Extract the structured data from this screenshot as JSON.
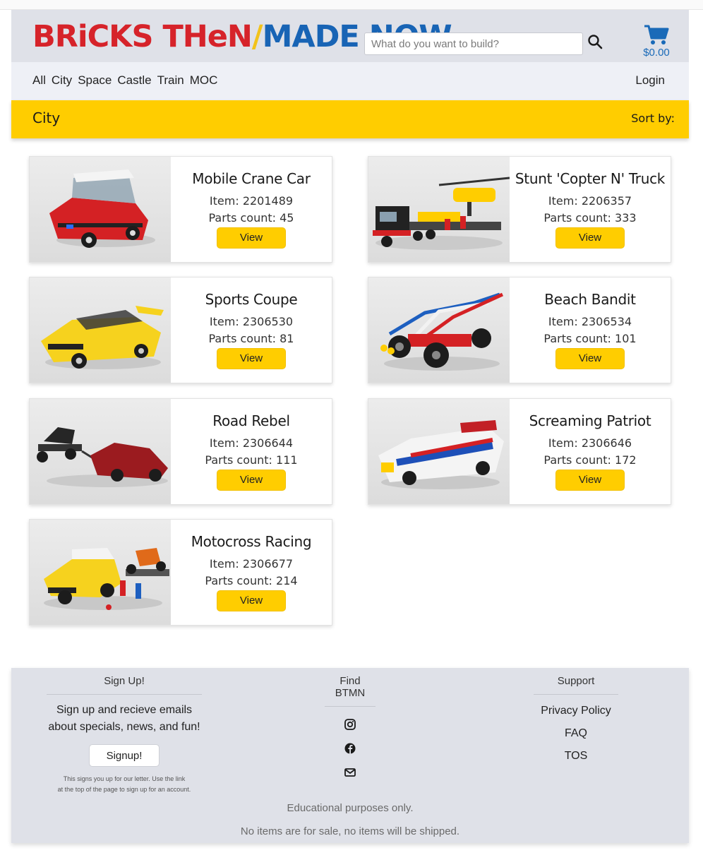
{
  "header": {
    "logo": {
      "part1": "BRiCKS THeN",
      "slash": "/",
      "part2": "MADE NOW"
    },
    "search": {
      "placeholder": "What do you want to build?"
    },
    "cart_total": "$0.00"
  },
  "nav": {
    "links": [
      "All",
      "City",
      "Space",
      "Castle",
      "Train",
      "MOC"
    ],
    "login": "Login"
  },
  "category": {
    "title": "City",
    "sort_label": "Sort by:"
  },
  "products": [
    {
      "name": "Mobile Crane Car",
      "item": "Item: 2201489",
      "parts": "Parts count: 45",
      "view": "View"
    },
    {
      "name": "Stunt 'Copter N' Truck",
      "item": "Item: 2206357",
      "parts": "Parts count: 333",
      "view": "View"
    },
    {
      "name": "Sports Coupe",
      "item": "Item: 2306530",
      "parts": "Parts count: 81",
      "view": "View"
    },
    {
      "name": "Beach Bandit",
      "item": "Item: 2306534",
      "parts": "Parts count: 101",
      "view": "View"
    },
    {
      "name": "Road Rebel",
      "item": "Item: 2306644",
      "parts": "Parts count: 111",
      "view": "View"
    },
    {
      "name": "Screaming Patriot",
      "item": "Item: 2306646",
      "parts": "Parts count: 172",
      "view": "View"
    },
    {
      "name": "Motocross Racing",
      "item": "Item: 2306677",
      "parts": "Parts count: 214",
      "view": "View"
    }
  ],
  "footer": {
    "signup": {
      "heading": "Sign Up!",
      "text_line1": "Sign up and recieve emails",
      "text_line2": "about specials, news, and fun!",
      "button": "Signup!",
      "fine_line1": "This signs you up for our letter. Use the link",
      "fine_line2": "at the top of the page to sign up for an account."
    },
    "find": {
      "heading": "Find BTMN",
      "icons": [
        "instagram-icon",
        "facebook-icon",
        "envelope-icon"
      ]
    },
    "support": {
      "heading": "Support",
      "links": [
        "Privacy Policy",
        "FAQ",
        "TOS"
      ]
    },
    "disclaimer1": "Educational purposes only.",
    "disclaimer2": "No items are for sale, no items will be shipped."
  },
  "colors": {
    "brand_red": "#d6232a",
    "brand_blue": "#1864b5",
    "accent_yellow": "#ffcd00",
    "header_bg": "#dfe1e8"
  }
}
